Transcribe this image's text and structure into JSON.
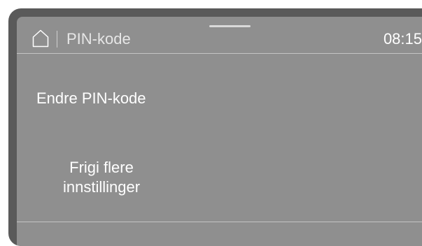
{
  "header": {
    "title": "PIN-kode",
    "time": "08:15",
    "home_icon": "home-icon"
  },
  "menu": {
    "change_pin": "Endre PIN-kode",
    "unlock_line1": "Frigi flere",
    "unlock_line2": "innstillinger"
  },
  "colors": {
    "bezel": "#5a5a5a",
    "screen": "#8f8f8f",
    "text": "#ffffff"
  }
}
